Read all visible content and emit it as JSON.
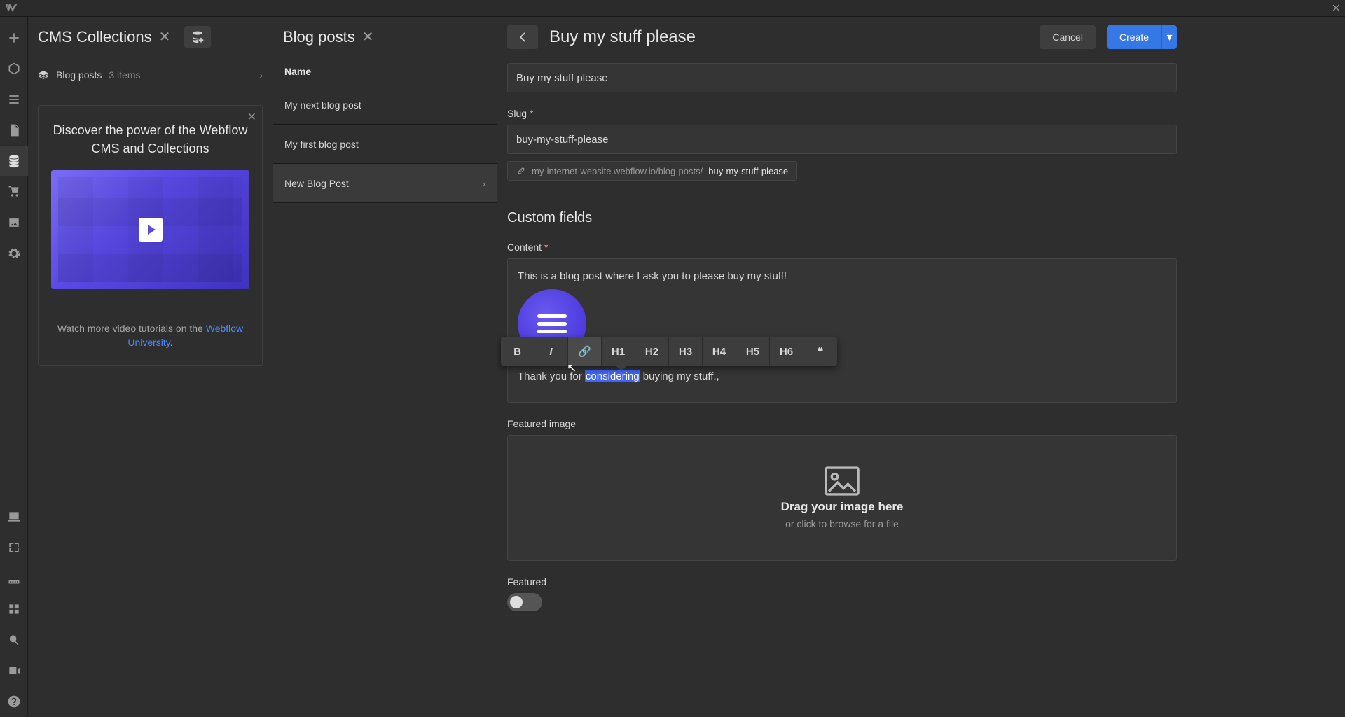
{
  "topbar": {
    "window_close_glyph": "✕"
  },
  "left_rail": {
    "items": [
      {
        "name": "add",
        "active": false
      },
      {
        "name": "cube",
        "active": false
      },
      {
        "name": "nav",
        "active": false
      },
      {
        "name": "page",
        "active": false
      },
      {
        "name": "cms",
        "active": true
      },
      {
        "name": "commerce",
        "active": false
      },
      {
        "name": "assets",
        "active": false
      },
      {
        "name": "settings",
        "active": false
      }
    ],
    "bottom_items": [
      {
        "name": "audit"
      },
      {
        "name": "target"
      },
      {
        "name": "ruler"
      },
      {
        "name": "apps"
      },
      {
        "name": "search"
      },
      {
        "name": "video"
      },
      {
        "name": "help"
      }
    ]
  },
  "cms_panel": {
    "title": "CMS Collections",
    "collection_name": "Blog posts",
    "collection_items_label": "3 items",
    "promo": {
      "title": "Discover the power of the Webflow CMS and Collections",
      "foot_prefix": "Watch more video tutorials on the ",
      "foot_link": "Webflow University",
      "foot_suffix": "."
    }
  },
  "list_panel": {
    "title": "Blog posts",
    "column_header": "Name",
    "rows": [
      {
        "name": "My next blog post",
        "active": false
      },
      {
        "name": "My first blog post",
        "active": false
      },
      {
        "name": "New Blog Post",
        "active": true
      }
    ]
  },
  "editor": {
    "title": "Buy my stuff please",
    "cancel_label": "Cancel",
    "create_label": "Create",
    "name_input_value": "Buy my stuff please",
    "slug_label": "Slug",
    "slug_value": "buy-my-stuff-please",
    "url_prefix": "my-internet-website.webflow.io/blog-posts/",
    "url_slug": "buy-my-stuff-please",
    "custom_fields_heading": "Custom fields",
    "content_label": "Content",
    "content_para1": "This is a blog post where I ask you to please buy my stuff!",
    "content_para2_prefix": "Thank you for ",
    "content_para2_selected": "considering",
    "content_para2_suffix": " buying my stuff.,",
    "toolbar": {
      "bold": "B",
      "italic": "I",
      "link": "🔗",
      "h1": "H1",
      "h2": "H2",
      "h3": "H3",
      "h4": "H4",
      "h5": "H5",
      "h6": "H6",
      "quote": "❝"
    },
    "featured_image_label": "Featured image",
    "dropzone_title": "Drag your image here",
    "dropzone_sub": "or click to browse for a file",
    "featured_label": "Featured"
  }
}
